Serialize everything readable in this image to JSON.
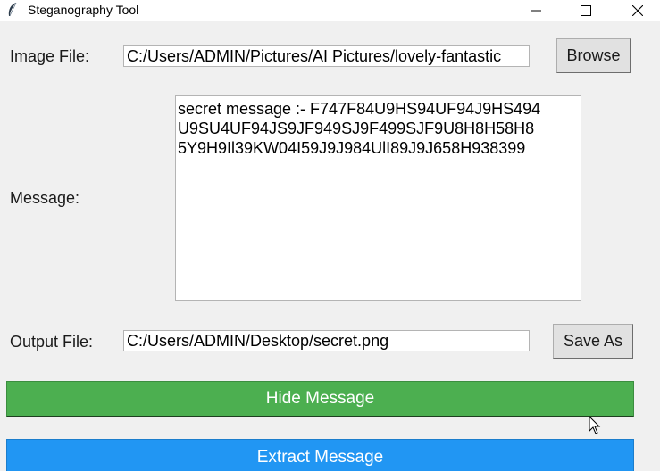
{
  "window": {
    "title": "Steganography Tool",
    "icon": "feather-icon",
    "controls": [
      "minimize-icon",
      "maximize-icon",
      "close-icon"
    ]
  },
  "form": {
    "image_label": "Image File:",
    "image_path": "C:/Users/ADMIN/Pictures/AI Pictures/lovely-fantastic",
    "browse_label": "Browse",
    "message_label": "Message:",
    "message_lines": [
      "secret message :- F747F84U9HS94UF94J9HS494",
      "U9SU4UF94JS9JF949SJ9F499SJF9U8H8H58H8",
      "5Y9H9Il39KW04I59J9J984UlI89J9J658H938399"
    ],
    "output_label": "Output File:",
    "output_path": "C:/Users/ADMIN/Desktop/secret.png",
    "save_as_label": "Save As"
  },
  "actions": {
    "hide_label": "Hide Message",
    "extract_label": "Extract Message"
  },
  "colors": {
    "hide_button": "#4caf50",
    "extract_button": "#2196f3"
  }
}
